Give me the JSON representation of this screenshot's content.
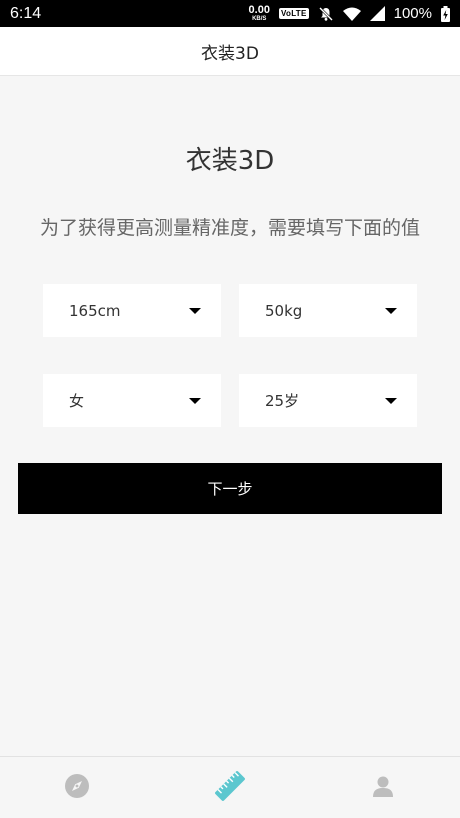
{
  "status_bar": {
    "time": "6:14",
    "net_speed_value": "0.00",
    "net_speed_unit": "KB/S",
    "volte": "VoLTE",
    "battery": "100%"
  },
  "header": {
    "title": "衣装3D"
  },
  "main": {
    "title": "衣装3D",
    "subtitle": "为了获得更高测量精准度，需要填写下面的值",
    "height_select": "165cm",
    "weight_select": "50kg",
    "gender_select": "女",
    "age_select": "25岁",
    "next_button": "下一步"
  },
  "bottom_nav": {
    "items": [
      {
        "icon": "compass-icon",
        "active": false
      },
      {
        "icon": "ruler-icon",
        "active": true
      },
      {
        "icon": "user-icon",
        "active": false
      }
    ],
    "active_color": "#5cc7cf",
    "inactive_color": "#bdbdbd"
  }
}
